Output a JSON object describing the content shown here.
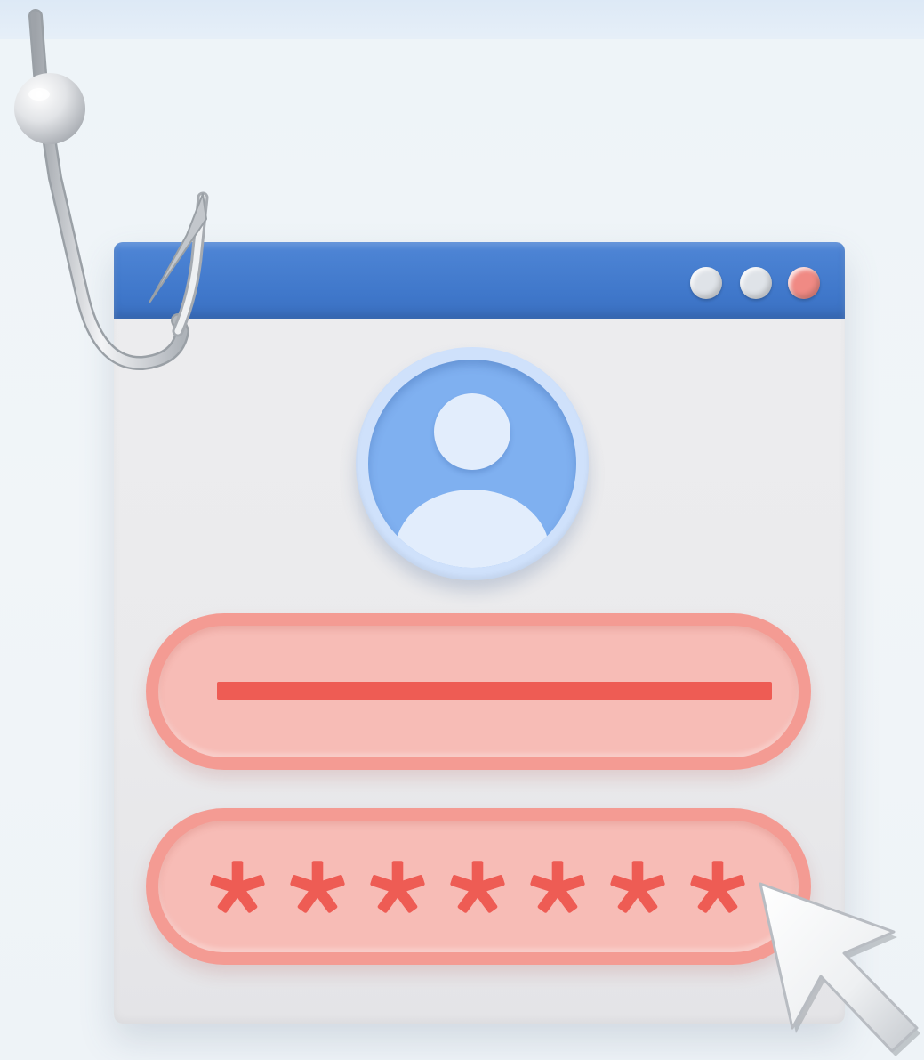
{
  "scene": {
    "kind": "phishing-illustration",
    "background_color": "#eef3f7",
    "window": {
      "titlebar_color": "#3f77ca",
      "controls": [
        {
          "name": "window-control-1",
          "color": "#dfe3e8"
        },
        {
          "name": "window-control-2",
          "color": "#dfe3e8"
        },
        {
          "name": "window-control-close",
          "color": "#f08a84"
        }
      ]
    },
    "avatar": {
      "icon": "user-icon",
      "color": "#7fb0f0"
    },
    "username_field": {
      "color": "#f7bcb6",
      "value_mark_color": "#ee5c54"
    },
    "password_field": {
      "color": "#f7bcb6",
      "mask_char_count": 7,
      "mask_icon": "asterisk-icon",
      "mask_color": "#ee5c54"
    },
    "fishing_hook": {
      "icon": "fishing-hook-icon",
      "color": "#c9ccd0"
    },
    "pointer": {
      "icon": "mouse-cursor-icon",
      "color": "#f4f4f6"
    }
  }
}
